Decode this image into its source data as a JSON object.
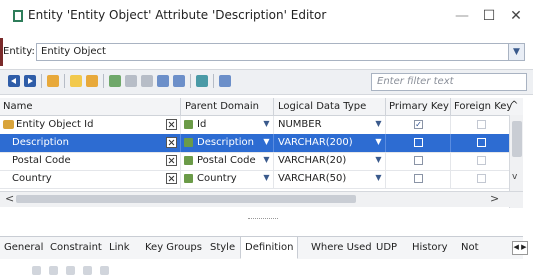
{
  "window": {
    "title": "Entity 'Entity Object' Attribute 'Description' Editor",
    "minimize": "—",
    "maximize": "☐",
    "close": "✕"
  },
  "entity": {
    "label": "Entity:",
    "value": "Entity Object"
  },
  "filter": {
    "placeholder": "Enter filter text"
  },
  "toolbar": {
    "icons": [
      "previous-icon",
      "next-icon",
      "add-attribute-icon",
      "copy-icon",
      "delete-icon",
      "add-key-icon",
      "move-top-icon",
      "move-up-icon",
      "move-down-icon",
      "move-bottom-icon",
      "domain-icon",
      "properties-icon"
    ]
  },
  "grid": {
    "columns": [
      "Name",
      "Parent Domain",
      "Logical Data Type",
      "Primary Key",
      "Foreign Key"
    ],
    "rows": [
      {
        "name": "Entity Object Id",
        "domain": "Id",
        "type": "NUMBER",
        "pk": true,
        "fk": false,
        "selected": false,
        "key": true
      },
      {
        "name": "Description",
        "domain": "Description",
        "type": "VARCHAR(200)",
        "pk": false,
        "fk": false,
        "selected": true,
        "key": false
      },
      {
        "name": "Postal Code",
        "domain": "Postal Code",
        "type": "VARCHAR(20)",
        "pk": false,
        "fk": false,
        "selected": false,
        "key": false
      },
      {
        "name": "Country",
        "domain": "Country",
        "type": "VARCHAR(50)",
        "pk": false,
        "fk": false,
        "selected": false,
        "key": false
      }
    ]
  },
  "tabs": [
    "General",
    "Constraint",
    "Link",
    "Key Groups",
    "Style",
    "Definition",
    "Where Used",
    "UDP",
    "History",
    "Not"
  ],
  "active_tab": "Definition",
  "colors": {
    "selection": "#2d6cd2",
    "toolbar_bg": "#eef0f3"
  }
}
